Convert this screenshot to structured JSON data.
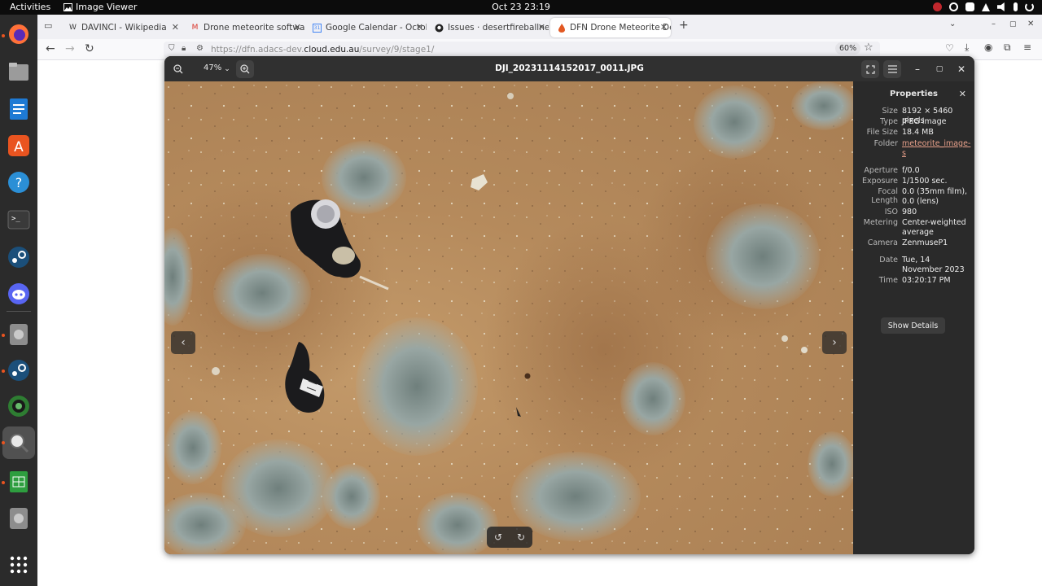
{
  "topbar": {
    "activities": "Activities",
    "app_name": "Image Viewer",
    "clock": "Oct 23  23:19"
  },
  "dock": {
    "items": [
      "firefox-icon",
      "files-icon",
      "writer-icon",
      "app-store-icon",
      "help-icon",
      "terminal-icon",
      "steam-icon",
      "discord-icon",
      "disk-icon",
      "steam-icon",
      "globe-icon",
      "image-viewer-icon",
      "spreadsheet-icon",
      "disk-icon",
      "app-grid-icon"
    ]
  },
  "browser": {
    "tabs": [
      {
        "label": "DAVINCI - Wikipedia",
        "icon": "W"
      },
      {
        "label": "Drone meteorite softwar",
        "icon": "M"
      },
      {
        "label": "Google Calendar - Octob",
        "icon": "31"
      },
      {
        "label": "Issues · desertfireballnet",
        "icon": "github-icon"
      },
      {
        "label": "DFN Drone Meteorite De",
        "icon": "flame-icon"
      }
    ],
    "url_prefix": "https://dfn.adacs-dev.",
    "url_domain": "cloud.edu.au",
    "url_suffix": "/survey/9/stage1/",
    "zoom": "60%"
  },
  "viewer": {
    "zoom_level": "47%",
    "title": "DJI_20231114152017_0011.JPG",
    "properties": {
      "title": "Properties",
      "rows": [
        {
          "key": "Size",
          "value": "8192 × 5460 pixels"
        },
        {
          "key": "Type",
          "value": "JPEG image"
        },
        {
          "key": "File Size",
          "value": "18.4 MB"
        },
        {
          "key": "Folder",
          "value": "meteorite_image-s"
        },
        {
          "key": "Aperture",
          "value": "f/0.0"
        },
        {
          "key": "Exposure",
          "value": "1/1500 sec."
        },
        {
          "key": "Focal Length",
          "value": "0.0 (35mm film), 0.0 (lens)"
        },
        {
          "key": "ISO",
          "value": "980"
        },
        {
          "key": "Metering",
          "value": "Center-weighted average"
        },
        {
          "key": "Camera",
          "value": "ZenmuseP1"
        },
        {
          "key": "Date",
          "value": "Tue, 14 November 2023"
        },
        {
          "key": "Time",
          "value": "03:20:17 PM"
        }
      ],
      "show_details": "Show Details"
    }
  }
}
